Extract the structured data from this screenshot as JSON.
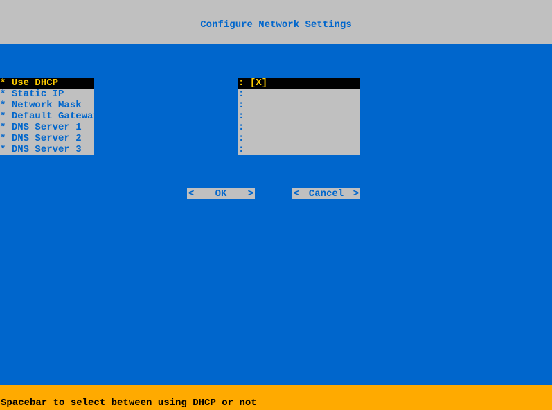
{
  "header": {
    "title": "Configure Network Settings"
  },
  "menu": {
    "items": [
      {
        "label": "Use DHCP",
        "selected": true
      },
      {
        "label": "Static IP",
        "selected": false
      },
      {
        "label": "Network Mask",
        "selected": false
      },
      {
        "label": "Default Gateway",
        "selected": false
      },
      {
        "label": "DNS Server 1",
        "selected": false
      },
      {
        "label": "DNS Server 2",
        "selected": false
      },
      {
        "label": "DNS Server 3",
        "selected": false
      }
    ]
  },
  "values": {
    "items": [
      {
        "value": "[X]",
        "selected": true
      },
      {
        "value": "",
        "selected": false
      },
      {
        "value": "",
        "selected": false
      },
      {
        "value": "",
        "selected": false
      },
      {
        "value": "",
        "selected": false
      },
      {
        "value": "",
        "selected": false
      },
      {
        "value": "",
        "selected": false
      }
    ]
  },
  "buttons": {
    "ok": "OK",
    "cancel": "Cancel"
  },
  "footer": {
    "hint": "Spacebar to select between using DHCP or not"
  },
  "marker": "*",
  "bracket_left": "<",
  "bracket_right": ">",
  "colon": ":"
}
